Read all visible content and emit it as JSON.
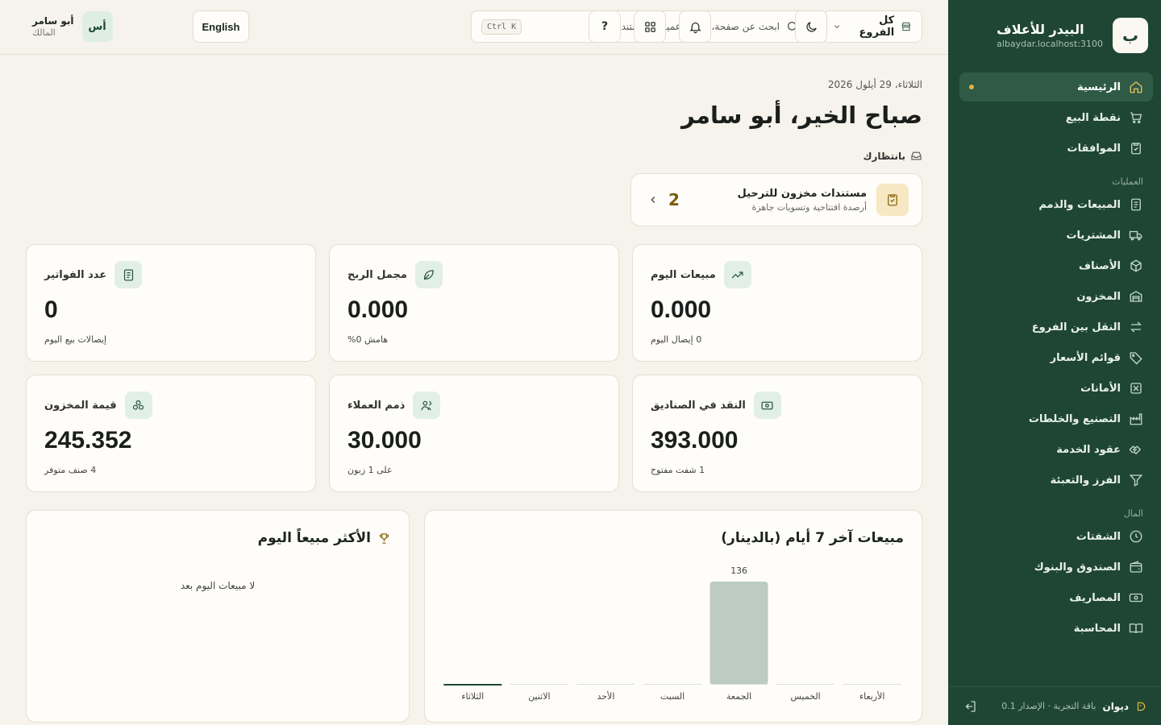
{
  "brand": {
    "logo_letter": "ب",
    "name": "البيدر للأعلاف",
    "host": "albaydar.localhost:3100"
  },
  "nav": {
    "items": [
      {
        "label": "الرئيسية",
        "icon": "home-icon",
        "active": true
      },
      {
        "label": "نقطة البيع",
        "icon": "cart-icon"
      },
      {
        "label": "الموافقات",
        "icon": "clipboard-check-icon"
      }
    ],
    "section_operations": "العمليات",
    "operations": [
      {
        "label": "المبيعات والذمم",
        "icon": "receipt-icon"
      },
      {
        "label": "المشتريات",
        "icon": "truck-icon"
      },
      {
        "label": "الأصناف",
        "icon": "box-icon"
      },
      {
        "label": "المخزون",
        "icon": "warehouse-icon"
      },
      {
        "label": "النقل بين الفروع",
        "icon": "transfer-icon"
      },
      {
        "label": "قوائم الأسعار",
        "icon": "tag-icon"
      },
      {
        "label": "الأمانات",
        "icon": "consignment-icon"
      },
      {
        "label": "التصنيع والخلطات",
        "icon": "factory-icon"
      },
      {
        "label": "عقود الخدمة",
        "icon": "handshake-icon"
      },
      {
        "label": "الفرز والتعبئة",
        "icon": "filter-icon"
      }
    ],
    "section_finance": "المال",
    "finance": [
      {
        "label": "الشفتات",
        "icon": "clock-icon"
      },
      {
        "label": "الصندوق والبنوك",
        "icon": "wallet-icon"
      },
      {
        "label": "المصاريف",
        "icon": "banknote-icon"
      },
      {
        "label": "المحاسبة",
        "icon": "book-icon"
      }
    ]
  },
  "footer": {
    "brand": "ديوان",
    "plan": "باقة التجربة · الإصدار 0.1"
  },
  "topbar": {
    "branch": "كل الفروع",
    "search_placeholder": "ابحث عن صفحة، صنف، عميل أو مستند...",
    "search_shortcut": "Ctrl K",
    "help": "?",
    "language": "English",
    "user_name": "أبو سامر",
    "user_role": "المالك",
    "avatar": "أس"
  },
  "main": {
    "date": "الثلاثاء، 29 أيلول 2026",
    "greeting": "صباح الخير، أبو سامر",
    "pending_label": "بانتظارك",
    "pending_card": {
      "title": "مستندات مخزون للترحيل",
      "subtitle": "أرصدة افتتاحية وتسويات جاهزة",
      "count": "2"
    }
  },
  "stats": [
    {
      "label": "مبيعات اليوم",
      "value": "0.000",
      "sub": "0 إيصال اليوم",
      "icon": "trending-up-icon"
    },
    {
      "label": "مجمل الربح",
      "value": "0.000",
      "sub": "هامش 0%",
      "icon": "leaf-icon"
    },
    {
      "label": "عدد الفواتير",
      "value": "0",
      "sub": "إيصالات بيع اليوم",
      "icon": "document-icon"
    },
    {
      "label": "النقد في الصناديق",
      "value": "393.000",
      "sub": "1 شفت مفتوح",
      "icon": "cash-icon"
    },
    {
      "label": "ذمم العملاء",
      "value": "30.000",
      "sub": "على 1 زبون",
      "icon": "users-icon"
    },
    {
      "label": "قيمة المخزون",
      "value": "245.352",
      "sub": "4 صنف متوفر",
      "icon": "boxes-icon"
    }
  ],
  "top_selling": {
    "title": "الأكثر مبيعاً اليوم",
    "empty": "لا مبيعات اليوم بعد"
  },
  "chart_data": {
    "type": "bar",
    "title": "مبيعات آخر 7 أيام (بالدينار)",
    "categories": [
      "الأربعاء",
      "الخميس",
      "الجمعة",
      "السبت",
      "الأحد",
      "الاثنين",
      "الثلاثاء"
    ],
    "values": [
      0,
      0,
      136,
      0,
      0,
      0,
      0
    ],
    "ylim": [
      0,
      136
    ],
    "bar_color": "#bccbc4",
    "highlight_color": "#1f4634",
    "highlight_index": 6
  }
}
